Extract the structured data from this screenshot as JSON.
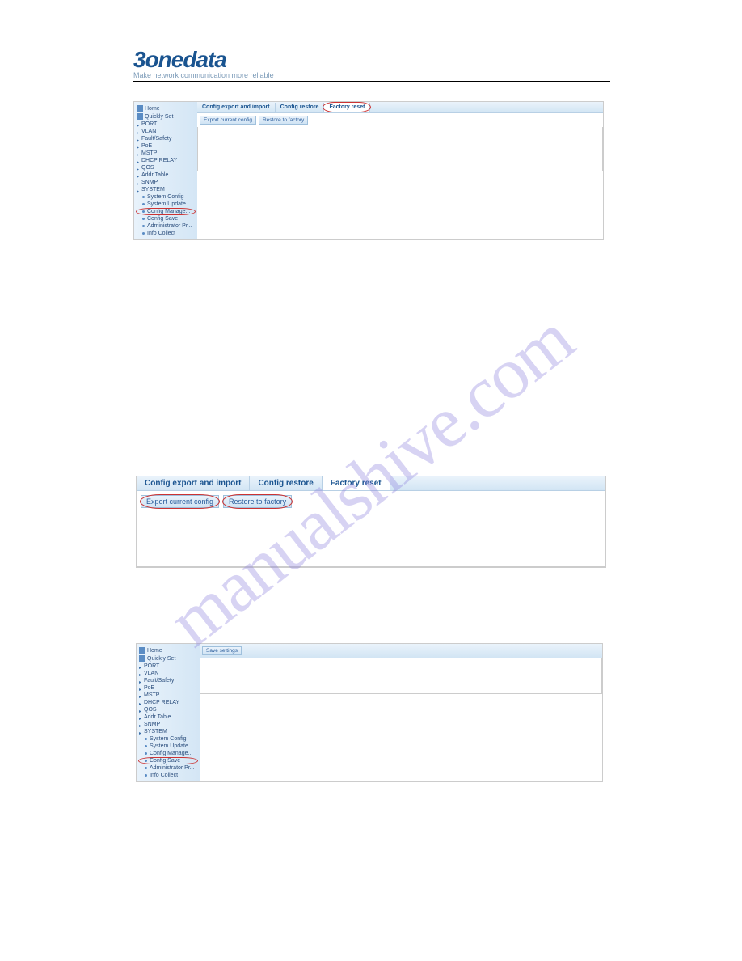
{
  "brand": {
    "logo_prefix": "3",
    "logo_main": "onedata",
    "tagline": "Make network communication more reliable"
  },
  "sidebar1": {
    "home": "Home",
    "quickly_set": "Quickly Set",
    "items": [
      "PORT",
      "VLAN",
      "Fault/Safety",
      "PoE",
      "MSTP",
      "DHCP RELAY",
      "QOS",
      "Addr Table",
      "SNMP",
      "SYSTEM"
    ],
    "sys_children": [
      "System Config",
      "System Update",
      "Config Manage...",
      "Config Save",
      "Administrator Pr...",
      "Info Collect"
    ],
    "sys_highlight_idx": 2
  },
  "tabs1": [
    "Config export and import",
    "Config restore",
    "Factory reset"
  ],
  "tabs1_active_idx": 2,
  "btns1": [
    "Export current config",
    "Restore to factory"
  ],
  "tabs2": [
    "Config export and import",
    "Config restore",
    "Factory reset"
  ],
  "tabs2_active_idx": 2,
  "btns2": [
    "Export current config",
    "Restore to factory"
  ],
  "sidebar3": {
    "home": "Home",
    "quickly_set": "Quickly Set",
    "items": [
      "PORT",
      "VLAN",
      "Fault/Safety",
      "PoE",
      "MSTP",
      "DHCP RELAY",
      "QOS",
      "Addr Table",
      "SNMP",
      "SYSTEM"
    ],
    "sys_children": [
      "System Config",
      "System Update",
      "Config Manage...",
      "Config Save",
      "Administrator Pr...",
      "Info Collect"
    ],
    "sys_highlight_idx": 3
  },
  "btn3": "Save settings",
  "watermark": "manualshive.com"
}
